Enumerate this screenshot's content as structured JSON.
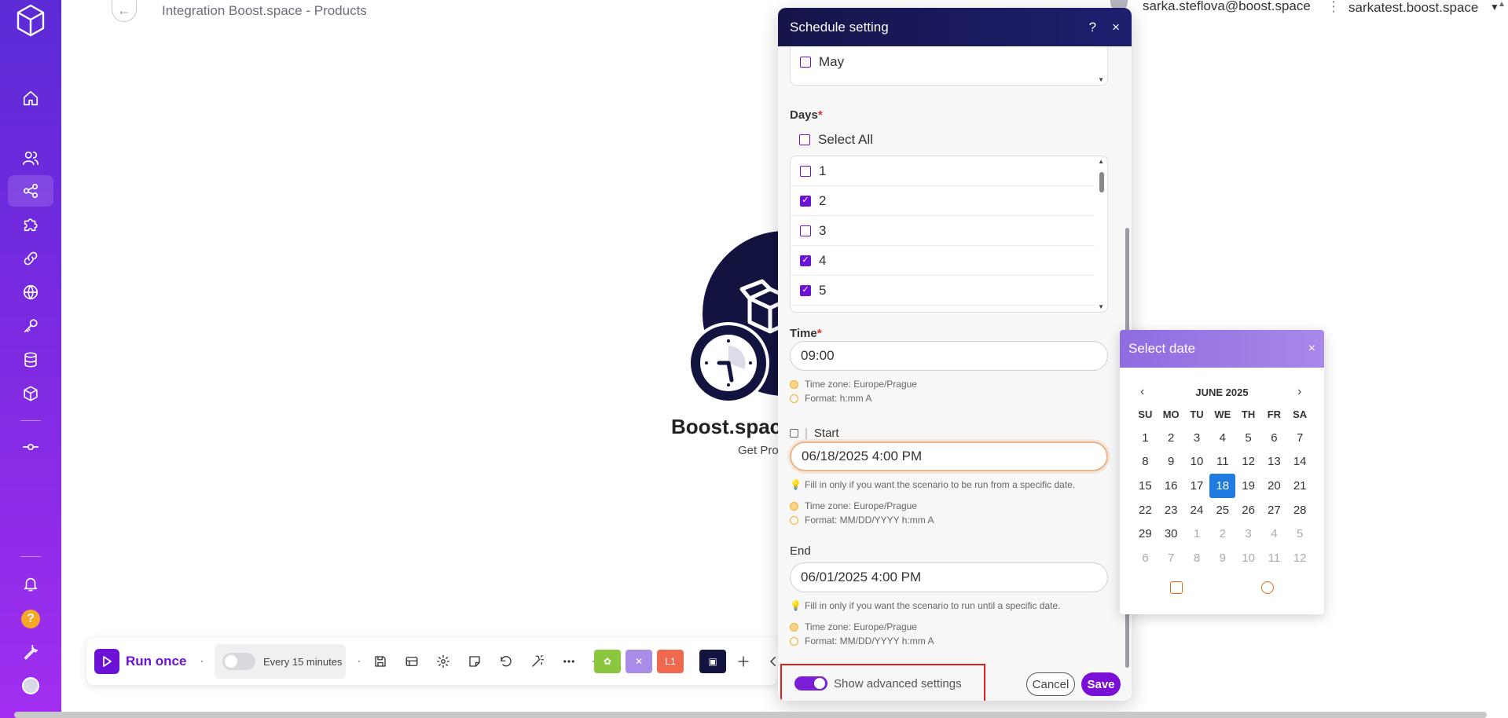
{
  "header": {
    "breadcrumb": "Integration Boost.space - Products",
    "user_email": "sarka.steflova@boost.space",
    "organization": "sarkatest.boost.space"
  },
  "sidebar": {
    "items": [
      "home-icon",
      "users-icon",
      "share-icon",
      "puzzle-icon",
      "link-icon",
      "globe-icon",
      "key-icon",
      "database-icon",
      "cube-icon",
      "commit-icon",
      "bell-icon",
      "help-icon",
      "wrench-icon",
      "avatar"
    ],
    "help_glyph": "?",
    "active": "share-icon"
  },
  "canvas": {
    "module_name": "Boost.space",
    "module_subtitle": "Get Pro"
  },
  "toolbar": {
    "run_once_label": "Run once",
    "schedule_label": "Every 15 minutes",
    "flow_glyph": "L1"
  },
  "modal": {
    "title": "Schedule setting",
    "help_glyph": "?",
    "close_glyph": "×",
    "month_item": "May",
    "days_label": "Days",
    "required_mark": "*",
    "select_all": "Select All",
    "days": [
      {
        "label": "1",
        "checked": false
      },
      {
        "label": "2",
        "checked": true
      },
      {
        "label": "3",
        "checked": false
      },
      {
        "label": "4",
        "checked": true
      },
      {
        "label": "5",
        "checked": true
      }
    ],
    "time_label": "Time",
    "time_value": "09:00",
    "time_timezone": "Time zone: Europe/Prague",
    "time_format": "Format: h:mm A",
    "start_label": "Start",
    "start_value": "06/18/2025 4:00 PM",
    "start_hint": "Fill in only if you want the scenario to be run from a specific date.",
    "start_timezone": "Time zone: Europe/Prague",
    "start_format": "Format: MM/DD/YYYY h:mm A",
    "end_label": "End",
    "end_value": "06/01/2025 4:00 PM",
    "end_hint": "Fill in only if you want the scenario to run until a specific date.",
    "end_timezone": "Time zone: Europe/Prague",
    "end_format": "Format: MM/DD/YYYY h:mm A",
    "advanced_label": "Show advanced settings",
    "advanced_enabled": true,
    "cancel_label": "Cancel",
    "save_label": "Save"
  },
  "datepicker": {
    "title": "Select date",
    "close_glyph": "×",
    "month": "JUNE 2025",
    "prev_glyph": "‹",
    "next_glyph": "›",
    "weekdays": [
      "SU",
      "MO",
      "TU",
      "WE",
      "TH",
      "FR",
      "SA"
    ],
    "weeks": [
      [
        "1",
        "2",
        "3",
        "4",
        "5",
        "6",
        "7"
      ],
      [
        "8",
        "9",
        "10",
        "11",
        "12",
        "13",
        "14"
      ],
      [
        "15",
        "16",
        "17",
        "18",
        "19",
        "20",
        "21"
      ],
      [
        "22",
        "23",
        "24",
        "25",
        "26",
        "27",
        "28"
      ],
      [
        "29",
        "30",
        "1",
        "2",
        "3",
        "4",
        "5"
      ],
      [
        "6",
        "7",
        "8",
        "9",
        "10",
        "11",
        "12"
      ]
    ],
    "selected": "18",
    "accent": "#1e7be0"
  },
  "colors": {
    "sidebar_top": "#5b2bd6",
    "sidebar_bottom": "#a22ef0",
    "brand_purple": "#6b12d6",
    "modal_header": "#15154a",
    "highlight_border": "#e02020"
  }
}
